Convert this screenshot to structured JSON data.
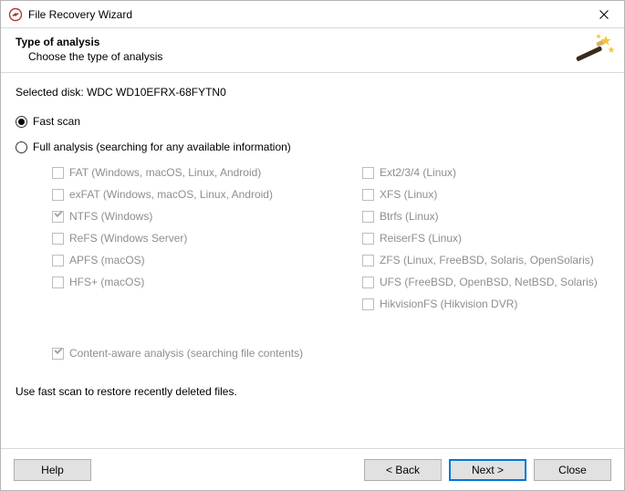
{
  "window": {
    "title": "File Recovery Wizard"
  },
  "header": {
    "title": "Type of analysis",
    "subtitle": "Choose the type of analysis"
  },
  "body": {
    "selected_disk_label": "Selected disk:",
    "selected_disk_value": "WDC WD10EFRX-68FYTN0",
    "fast_scan_label": "Fast scan",
    "full_analysis_label": "Full analysis (searching for any available information)",
    "content_aware_label": "Content-aware analysis (searching file contents)",
    "hint": "Use fast scan to restore recently deleted files."
  },
  "fs": {
    "fat": "FAT (Windows, macOS, Linux, Android)",
    "exfat": "exFAT (Windows, macOS, Linux, Android)",
    "ntfs": "NTFS (Windows)",
    "refs": "ReFS (Windows Server)",
    "apfs": "APFS (macOS)",
    "hfsplus": "HFS+ (macOS)",
    "ext": "Ext2/3/4 (Linux)",
    "xfs": "XFS (Linux)",
    "btrfs": "Btrfs (Linux)",
    "reiserfs": "ReiserFS (Linux)",
    "zfs": "ZFS (Linux, FreeBSD, Solaris, OpenSolaris)",
    "ufs": "UFS (FreeBSD, OpenBSD, NetBSD, Solaris)",
    "hikvision": "HikvisionFS (Hikvision DVR)"
  },
  "footer": {
    "help": "Help",
    "back": "< Back",
    "next": "Next >",
    "close": "Close"
  }
}
